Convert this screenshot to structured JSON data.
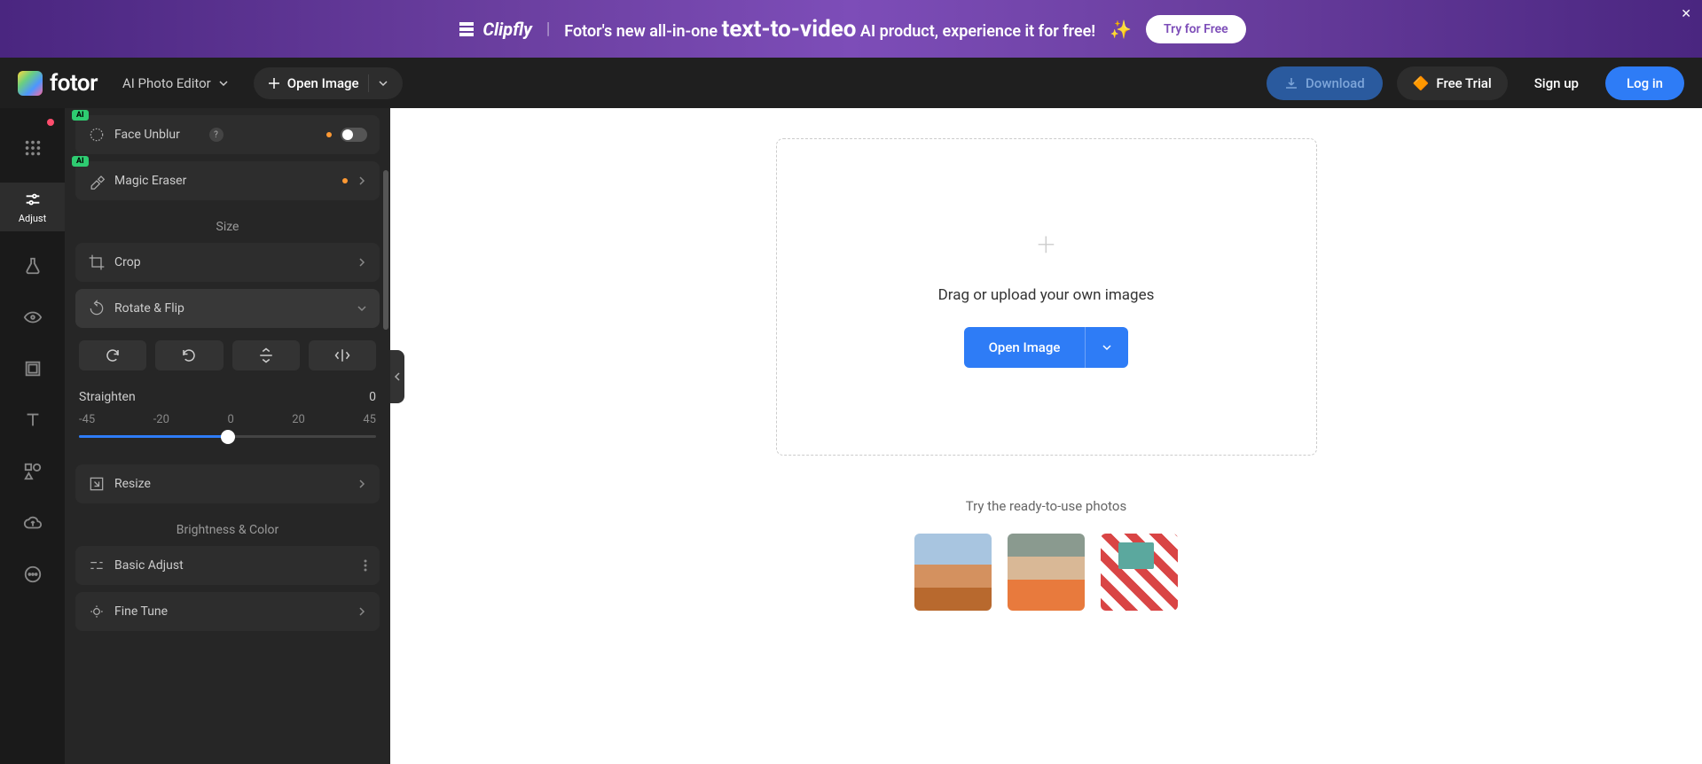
{
  "banner": {
    "brand": "Clipfly",
    "text_before": "Fotor's new all-in-one ",
    "highlight": "text-to-video",
    "text_after": " AI product, experience it for free!",
    "cta": "Try for Free"
  },
  "topbar": {
    "logo_text": "fotor",
    "editor_label": "AI Photo Editor",
    "open_image": "Open Image",
    "download": "Download",
    "free_trial": "Free  Trial",
    "signup": "Sign up",
    "login": "Log in"
  },
  "rail": {
    "adjust": "Adjust"
  },
  "panel": {
    "face_unblur": "Face Unblur",
    "magic_eraser": "Magic Eraser",
    "ai_badge": "AI",
    "size_header": "Size",
    "crop": "Crop",
    "rotate_flip": "Rotate & Flip",
    "straighten_label": "Straighten",
    "straighten_value": "0",
    "ticks": {
      "n45": "-45",
      "n20": "-20",
      "zero": "0",
      "p20": "20",
      "p45": "45"
    },
    "resize": "Resize",
    "brightness_color": "Brightness & Color",
    "basic_adjust": "Basic Adjust",
    "fine_tune": "Fine Tune"
  },
  "canvas": {
    "drop_text": "Drag or upload your own images",
    "open_image": "Open Image",
    "try_label": "Try the ready-to-use photos"
  }
}
